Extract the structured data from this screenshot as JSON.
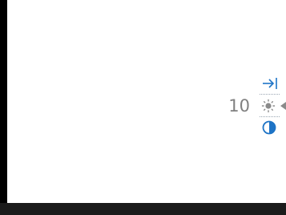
{
  "display": {
    "value": "10"
  },
  "menu": {
    "items": [
      {
        "icon": "exit-arrow-icon",
        "color": "#1e74c6"
      },
      {
        "icon": "brightness-sun-icon",
        "color": "#8a8a8a",
        "selected": true
      },
      {
        "icon": "contrast-icon",
        "color": "#1e74c6"
      }
    ]
  },
  "colors": {
    "accent": "#1e74c6",
    "value_text": "#808080",
    "inactive_icon": "#8a8a8a",
    "bottom_bar": "#1b1b1b"
  }
}
